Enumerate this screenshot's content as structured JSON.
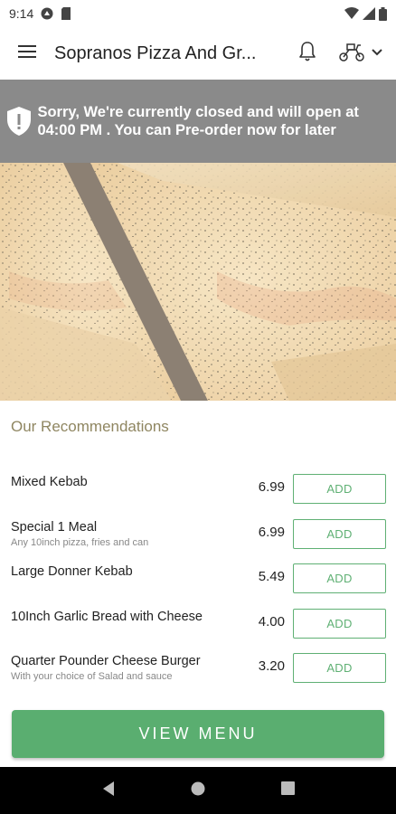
{
  "status_bar": {
    "time": "9:14"
  },
  "app_bar": {
    "title": "Sopranos Pizza And Gr..."
  },
  "banner": {
    "text": "Sorry, We're currently closed and will open at 04:00 PM . You can Pre-order now for later"
  },
  "section": {
    "title": "Our Recommendations"
  },
  "items": [
    {
      "name": "Mixed Kebab",
      "description": "",
      "price": "6.99",
      "button": "ADD"
    },
    {
      "name": "Special 1 Meal",
      "description": "Any 10inch pizza, fries and can",
      "price": "6.99",
      "button": "ADD"
    },
    {
      "name": "Large Donner Kebab",
      "description": "",
      "price": "5.49",
      "button": "ADD"
    },
    {
      "name": "10Inch Garlic Bread with Cheese",
      "description": "",
      "price": "4.00",
      "button": "ADD"
    },
    {
      "name": "Quarter Pounder Cheese Burger",
      "description": "With your choice of Salad and sauce",
      "price": "3.20",
      "button": "ADD"
    }
  ],
  "cta": {
    "label": "VIEW MENU"
  },
  "colors": {
    "accent_green": "#5aae70",
    "banner_grey": "#8a8a8a",
    "section_title": "#8f8661"
  },
  "icons": [
    "menu-icon",
    "bell-icon",
    "delivery-scooter-icon",
    "chevron-down-icon",
    "shield-alert-icon",
    "back-icon",
    "home-icon",
    "recents-icon"
  ]
}
